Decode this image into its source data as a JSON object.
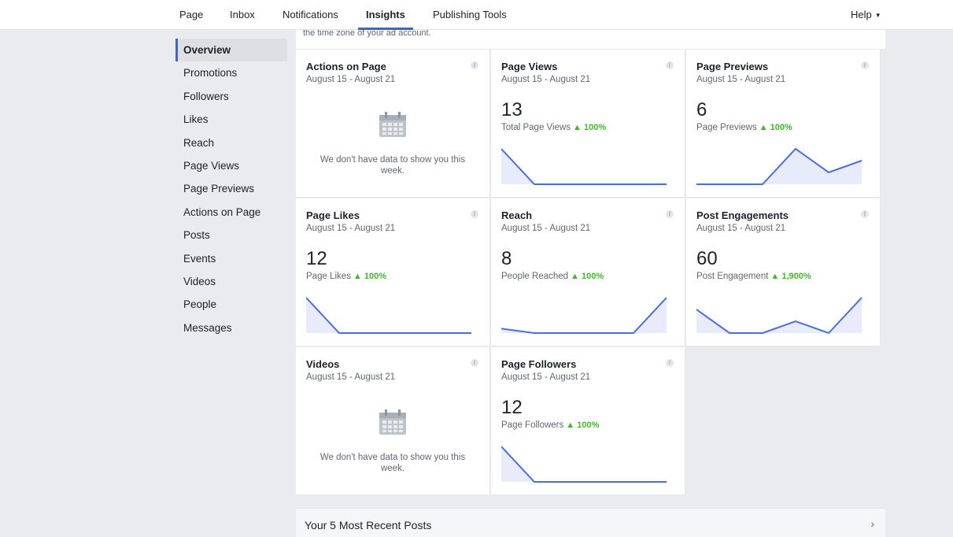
{
  "topnav": {
    "tabs": [
      {
        "label": "Page"
      },
      {
        "label": "Inbox"
      },
      {
        "label": "Notifications"
      },
      {
        "label": "Insights"
      },
      {
        "label": "Publishing Tools"
      }
    ],
    "active": "Insights",
    "help_label": "Help",
    "help_caret": "▼"
  },
  "sidebar": {
    "items": [
      {
        "label": "Overview"
      },
      {
        "label": "Promotions"
      },
      {
        "label": "Followers"
      },
      {
        "label": "Likes"
      },
      {
        "label": "Reach"
      },
      {
        "label": "Page Views"
      },
      {
        "label": "Page Previews"
      },
      {
        "label": "Actions on Page"
      },
      {
        "label": "Posts"
      },
      {
        "label": "Events"
      },
      {
        "label": "Videos"
      },
      {
        "label": "People"
      },
      {
        "label": "Messages"
      }
    ],
    "active": "Overview"
  },
  "notice": {
    "text": "the time zone of your ad account."
  },
  "cards": [
    {
      "title": "Actions on Page",
      "date": "August 15 - August 21",
      "empty": true,
      "empty_text": "We don't have data to show you this week."
    },
    {
      "title": "Page Views",
      "date": "August 15 - August 21",
      "value": "13",
      "metric": "Total Page Views",
      "change": "100%",
      "trend": [
        13,
        0,
        0,
        0,
        0,
        0
      ]
    },
    {
      "title": "Page Previews",
      "date": "August 15 - August 21",
      "value": "6",
      "metric": "Page Previews",
      "change": "100%",
      "trend": [
        0,
        0,
        0,
        3,
        1,
        2
      ]
    },
    {
      "title": "Page Likes",
      "date": "August 15 - August 21",
      "value": "12",
      "metric": "Page Likes",
      "change": "100%",
      "trend": [
        12,
        0,
        0,
        0,
        0,
        0
      ]
    },
    {
      "title": "Reach",
      "date": "August 15 - August 21",
      "value": "8",
      "metric": "People Reached",
      "change": "100%",
      "trend": [
        1,
        0,
        0,
        0,
        0,
        8
      ]
    },
    {
      "title": "Post Engagements",
      "date": "August 15 - August 21",
      "value": "60",
      "metric": "Post Engagement",
      "change": "1,900%",
      "trend": [
        20,
        0,
        0,
        10,
        0,
        30
      ]
    },
    {
      "title": "Videos",
      "date": "August 15 - August 21",
      "empty": true,
      "empty_text": "We don't have data to show you this week."
    },
    {
      "title": "Page Followers",
      "date": "August 15 - August 21",
      "value": "12",
      "metric": "Page Followers",
      "change": "100%",
      "trend": [
        12,
        0,
        0,
        0,
        0,
        0
      ]
    }
  ],
  "recent": {
    "label": "Your 5 Most Recent Posts",
    "chevron": "›"
  },
  "colors": {
    "accent": "#4267b2",
    "line": "#4a6ee0",
    "area": "#e8ecfa",
    "up": "#42b72a"
  }
}
